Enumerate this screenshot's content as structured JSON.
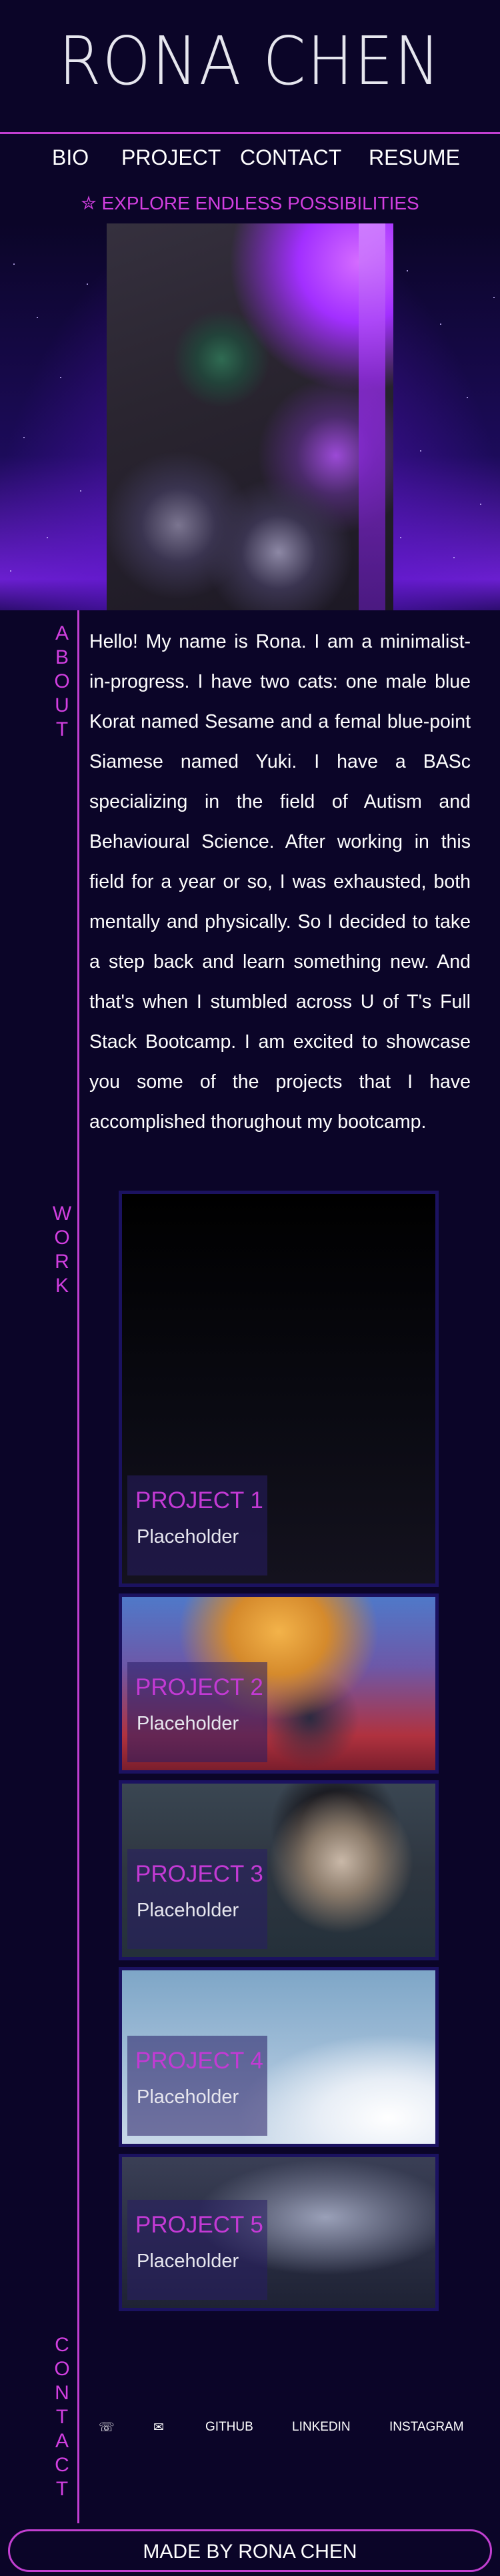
{
  "header": {
    "title": "RONA CHEN"
  },
  "nav": {
    "items": [
      {
        "label": "BIO"
      },
      {
        "label": "PROJECT"
      },
      {
        "label": "CONTACT"
      },
      {
        "label": "RESUME"
      }
    ]
  },
  "tagline": "✮ EXPLORE ENDLESS POSSIBILITIES",
  "sections": {
    "about": [
      "A",
      "B",
      "O",
      "U",
      "T"
    ],
    "work": [
      "W",
      "O",
      "R",
      "K"
    ],
    "contact": [
      "C",
      "O",
      "N",
      "T",
      "A",
      "C",
      "T"
    ]
  },
  "about": {
    "text": "Hello! My name is Rona. I am a minimalist-in-progress. I have two cats: one male blue Korat named Sesame and a femal blue-point Siamese named Yuki. I have a BASc specializing in the field of Autism and Behavioural Science. After working in this field for a year or so, I was exhausted, both mentally and physically. So I decided to take a step back and learn something new. And that's when I stumbled across U of T's Full Stack Bootcamp. I am excited to showcase you some of the projects that I have accomplished thorughout my bootcamp."
  },
  "projects": [
    {
      "title": "PROJECT 1",
      "subtitle": "Placeholder"
    },
    {
      "title": "PROJECT 2",
      "subtitle": "Placeholder"
    },
    {
      "title": "PROJECT 3",
      "subtitle": "Placeholder"
    },
    {
      "title": "PROJECT 4",
      "subtitle": "Placeholder"
    },
    {
      "title": "PROJECT 5",
      "subtitle": "Placeholder"
    }
  ],
  "contact": {
    "phone_icon": "☏",
    "email_icon": "✉",
    "links": [
      {
        "label": "GITHUB"
      },
      {
        "label": "LINKEDIN"
      },
      {
        "label": "INSTAGRAM"
      }
    ]
  },
  "footer": {
    "text": "MADE BY RONA CHEN"
  },
  "colors": {
    "background": "#0b0528",
    "accent": "#c23fd1",
    "accent_text": "#d23fe0"
  }
}
